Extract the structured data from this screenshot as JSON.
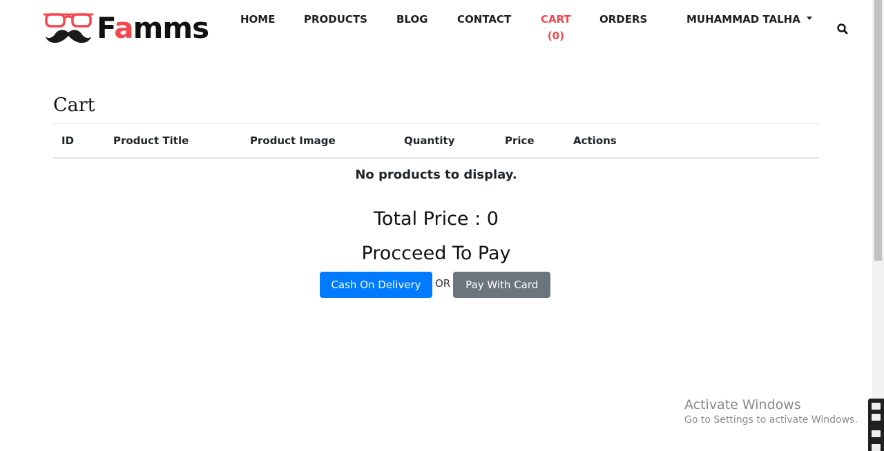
{
  "brand": {
    "name_prefix": "F",
    "name_accent": "a",
    "name_suffix": "mms",
    "accent_color": "#f7444e"
  },
  "nav": {
    "items": [
      "HOME",
      "PRODUCTS",
      "BLOG",
      "CONTACT"
    ],
    "cart_label": "CART",
    "cart_count": "(0)",
    "orders_label": "ORDERS",
    "user_label": "MUHAMMAD TALHA",
    "search_icon": "search-icon"
  },
  "cart": {
    "title": "Cart",
    "columns": [
      "ID",
      "Product Title",
      "Product Image",
      "Quantity",
      "Price",
      "Actions"
    ],
    "empty_message": "No products to display.",
    "total_price": "Total Price : 0",
    "proceed_heading": "Procceed To Pay",
    "cash_button": "Cash On Delivery",
    "or_text": "OR",
    "card_button": "Pay With Card"
  },
  "colors": {
    "primary": "#007bff",
    "secondary": "#6c757d",
    "accent": "#f7444e"
  },
  "watermark": {
    "title": "Activate Windows",
    "subtitle": "Go to Settings to activate Windows."
  }
}
